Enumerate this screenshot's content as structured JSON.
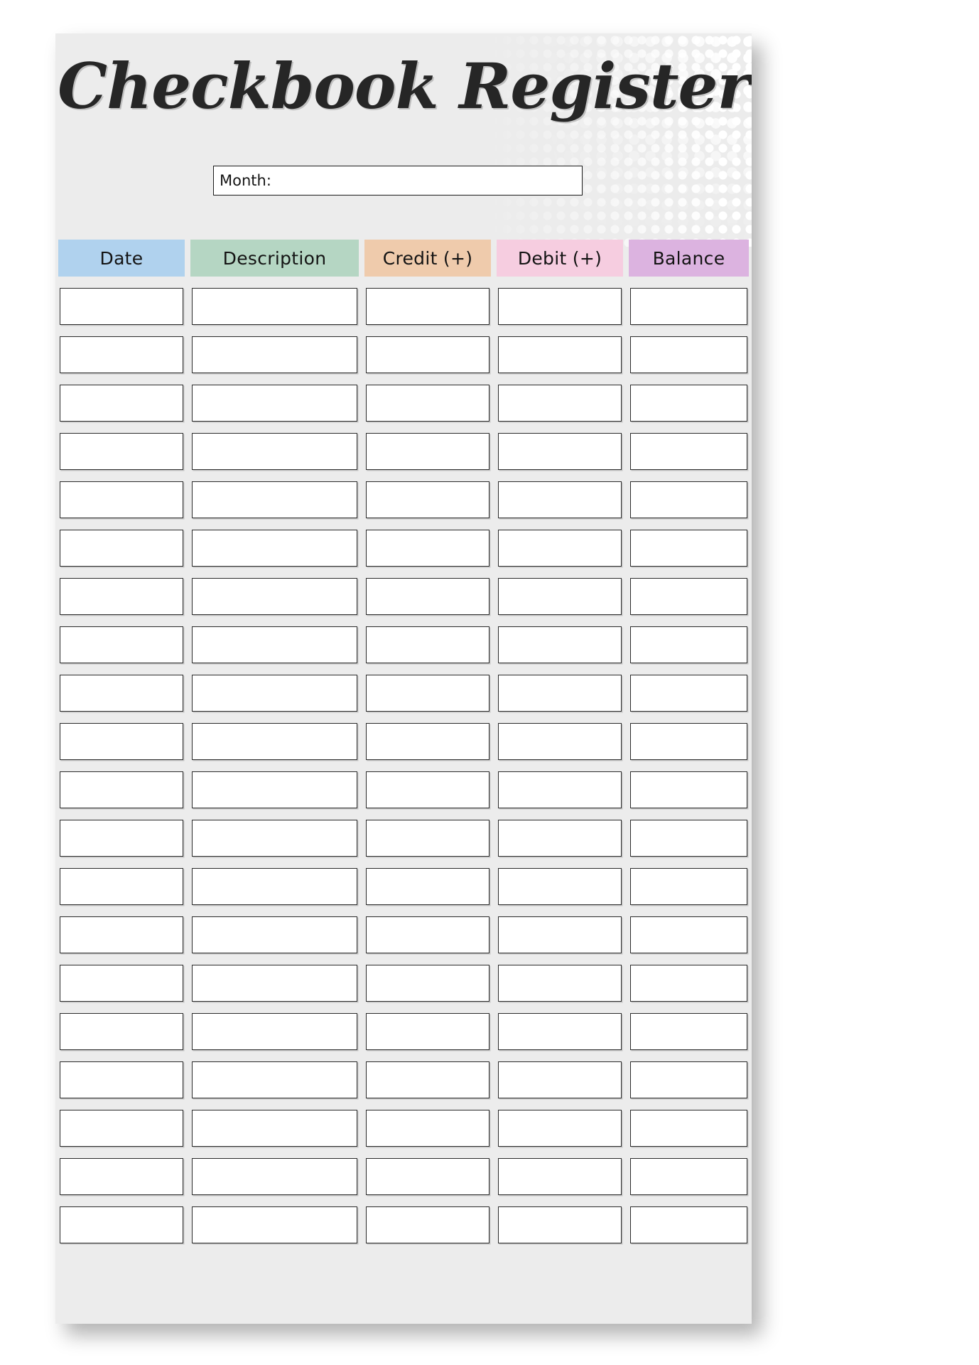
{
  "page": {
    "title": "Checkbook Register",
    "background_color": "#ececec",
    "title_color": "#262626"
  },
  "month_field": {
    "label": "Month:",
    "value": "",
    "placeholder": ""
  },
  "table": {
    "columns": [
      {
        "label": "Date",
        "color": "#b0d2ee"
      },
      {
        "label": "Description",
        "color": "#b5d6c3"
      },
      {
        "label": "Credit (+)",
        "color": "#efcbac"
      },
      {
        "label": "Debit (+)",
        "color": "#f6cde0"
      },
      {
        "label": "Balance",
        "color": "#dcb3e0"
      }
    ],
    "rows": [
      {
        "date": "",
        "description": "",
        "credit": "",
        "debit": "",
        "balance": ""
      },
      {
        "date": "",
        "description": "",
        "credit": "",
        "debit": "",
        "balance": ""
      },
      {
        "date": "",
        "description": "",
        "credit": "",
        "debit": "",
        "balance": ""
      },
      {
        "date": "",
        "description": "",
        "credit": "",
        "debit": "",
        "balance": ""
      },
      {
        "date": "",
        "description": "",
        "credit": "",
        "debit": "",
        "balance": ""
      },
      {
        "date": "",
        "description": "",
        "credit": "",
        "debit": "",
        "balance": ""
      },
      {
        "date": "",
        "description": "",
        "credit": "",
        "debit": "",
        "balance": ""
      },
      {
        "date": "",
        "description": "",
        "credit": "",
        "debit": "",
        "balance": ""
      },
      {
        "date": "",
        "description": "",
        "credit": "",
        "debit": "",
        "balance": ""
      },
      {
        "date": "",
        "description": "",
        "credit": "",
        "debit": "",
        "balance": ""
      },
      {
        "date": "",
        "description": "",
        "credit": "",
        "debit": "",
        "balance": ""
      },
      {
        "date": "",
        "description": "",
        "credit": "",
        "debit": "",
        "balance": ""
      },
      {
        "date": "",
        "description": "",
        "credit": "",
        "debit": "",
        "balance": ""
      },
      {
        "date": "",
        "description": "",
        "credit": "",
        "debit": "",
        "balance": ""
      },
      {
        "date": "",
        "description": "",
        "credit": "",
        "debit": "",
        "balance": ""
      },
      {
        "date": "",
        "description": "",
        "credit": "",
        "debit": "",
        "balance": ""
      },
      {
        "date": "",
        "description": "",
        "credit": "",
        "debit": "",
        "balance": ""
      },
      {
        "date": "",
        "description": "",
        "credit": "",
        "debit": "",
        "balance": ""
      },
      {
        "date": "",
        "description": "",
        "credit": "",
        "debit": "",
        "balance": ""
      },
      {
        "date": "",
        "description": "",
        "credit": "",
        "debit": "",
        "balance": ""
      }
    ]
  }
}
